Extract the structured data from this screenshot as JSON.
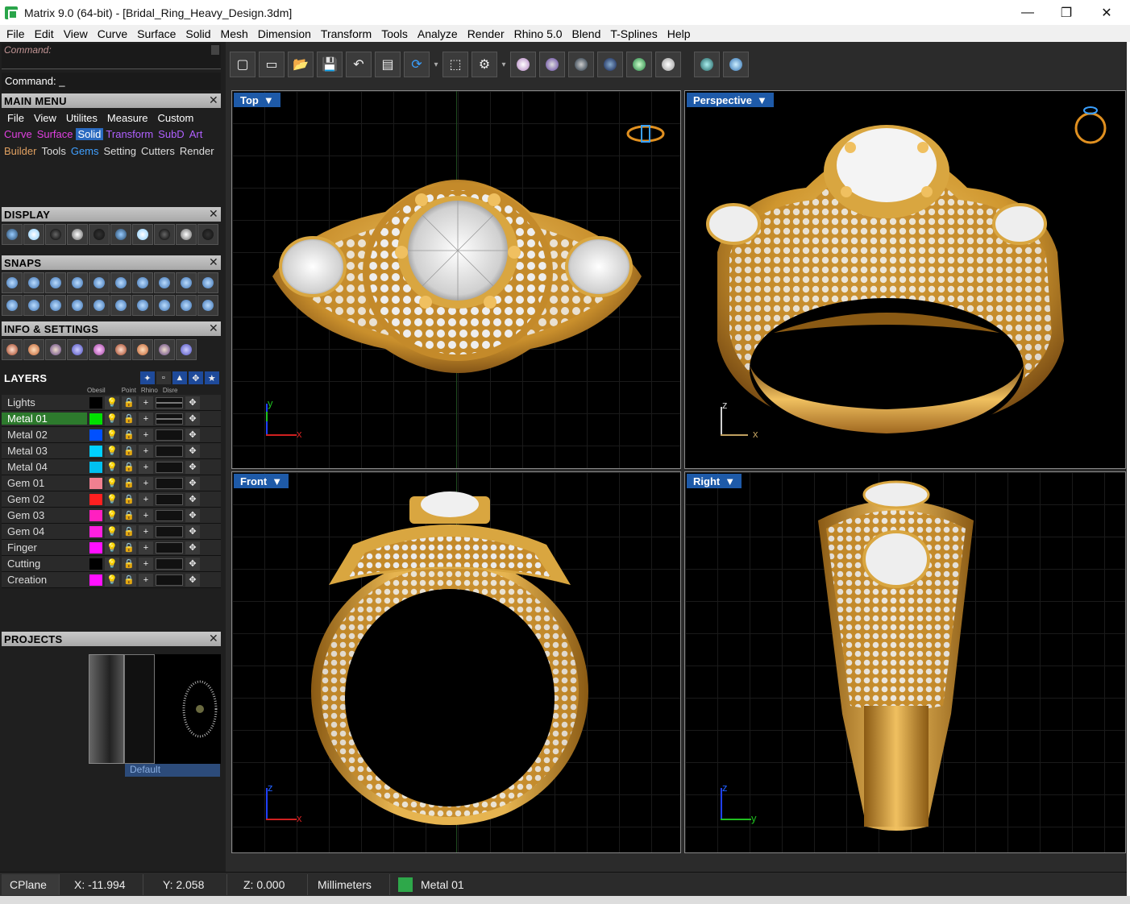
{
  "window": {
    "title": "Matrix 9.0 (64-bit) - [Bridal_Ring_Heavy_Design.3dm]",
    "minimize": "—",
    "maximize": "❐",
    "close": "✕"
  },
  "menubar": [
    "File",
    "Edit",
    "View",
    "Curve",
    "Surface",
    "Solid",
    "Mesh",
    "Dimension",
    "Transform",
    "Tools",
    "Analyze",
    "Render",
    "Rhino 5.0",
    "Blend",
    "T-Splines",
    "Help"
  ],
  "command": {
    "history": "Command:",
    "prompt": "Command: _"
  },
  "main_menu": {
    "title": "MAIN MENU",
    "row1": [
      "File",
      "View",
      "Utilites",
      "Measure",
      "Custom"
    ],
    "row2": [
      {
        "label": "Curve",
        "color": "#e040e0"
      },
      {
        "label": "Surface",
        "color": "#e040e0"
      },
      {
        "label": "Solid",
        "color": "#ffffff",
        "highlight": "#2a6ac0"
      },
      {
        "label": "Transform",
        "color": "#b060ff"
      },
      {
        "label": "SubD",
        "color": "#b060ff"
      },
      {
        "label": "Art",
        "color": "#b060ff"
      }
    ],
    "row3": [
      {
        "label": "Builder",
        "color": "#e0a060"
      },
      {
        "label": "Tools",
        "color": "#dddddd"
      },
      {
        "label": "Gems",
        "color": "#40a0ff"
      },
      {
        "label": "Setting",
        "color": "#dddddd"
      },
      {
        "label": "Cutters",
        "color": "#dddddd"
      },
      {
        "label": "Render",
        "color": "#dddddd"
      }
    ]
  },
  "display": {
    "title": "DISPLAY"
  },
  "snaps": {
    "title": "SNAPS"
  },
  "info_settings": {
    "title": "INFO & SETTINGS"
  },
  "layers": {
    "title": "LAYERS",
    "col_headers": [
      "Obesil",
      "Point",
      "Rhino",
      "Disre"
    ],
    "rows": [
      {
        "name": "Lights",
        "color": "#000000"
      },
      {
        "name": "Metal 01",
        "color": "#00e000",
        "active": true
      },
      {
        "name": "Metal 02",
        "color": "#0050ff"
      },
      {
        "name": "Metal 03",
        "color": "#00d0ff"
      },
      {
        "name": "Metal 04",
        "color": "#00c0f0"
      },
      {
        "name": "Gem 01",
        "color": "#f08090"
      },
      {
        "name": "Gem 02",
        "color": "#ff2020"
      },
      {
        "name": "Gem 03",
        "color": "#ff20c0"
      },
      {
        "name": "Gem 04",
        "color": "#ff20e0"
      },
      {
        "name": "Finger",
        "color": "#ff10ff"
      },
      {
        "name": "Cutting",
        "color": "#000000"
      },
      {
        "name": "Creation",
        "color": "#ff10ff"
      }
    ]
  },
  "projects": {
    "title": "PROJECTS",
    "default_label": "Default"
  },
  "viewports": {
    "top": "Top",
    "perspective": "Perspective",
    "front": "Front",
    "right": "Right",
    "axis": {
      "x": "x",
      "y": "y",
      "z": "z"
    }
  },
  "statusbar": {
    "cplane": "CPlane",
    "x": "X: -11.994",
    "y": "Y: 2.058",
    "z": "Z: 0.000",
    "units": "Millimeters",
    "layer": "Metal 01",
    "layer_color": "#2ea84a"
  },
  "colors": {
    "gold": "#d9a640",
    "gold_dark": "#8a5a14",
    "diamond": "#f2f2f2"
  }
}
